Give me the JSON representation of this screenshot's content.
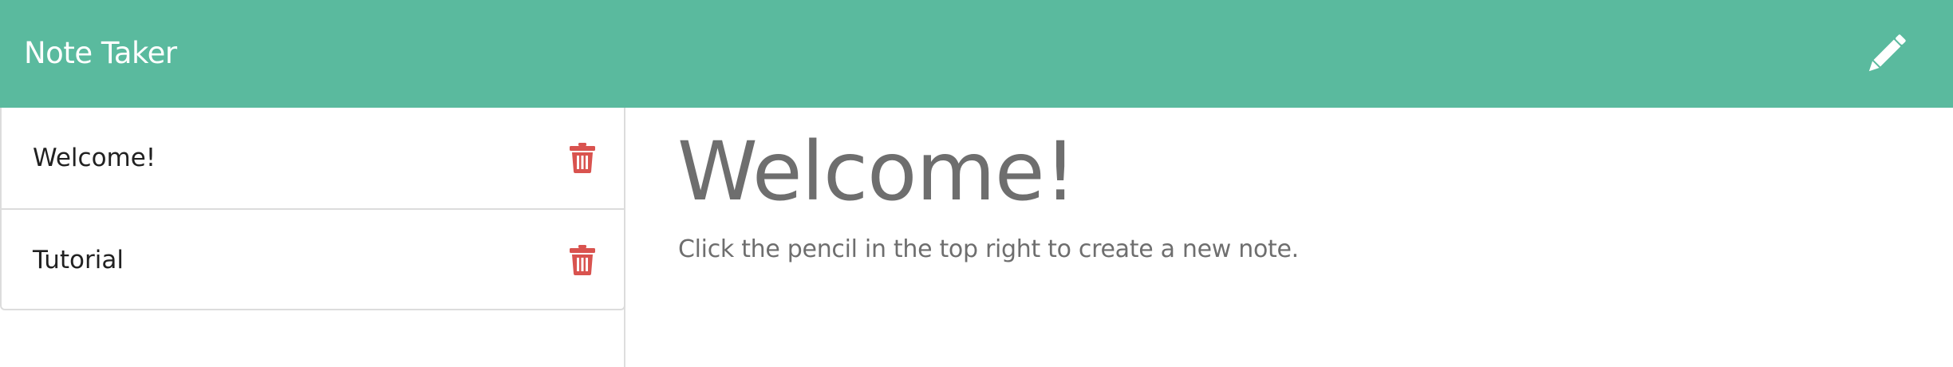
{
  "header": {
    "title": "Note Taker",
    "new_note_icon": "pencil-icon",
    "background_color": "#5aba9e"
  },
  "sidebar": {
    "notes": [
      {
        "title": "Welcome!",
        "delete_icon": "trash-icon"
      },
      {
        "title": "Tutorial",
        "delete_icon": "trash-icon"
      }
    ],
    "delete_icon_color": "#d9534f"
  },
  "main": {
    "title": "Welcome!",
    "body": "Click the pencil in the top right to create a new note."
  }
}
